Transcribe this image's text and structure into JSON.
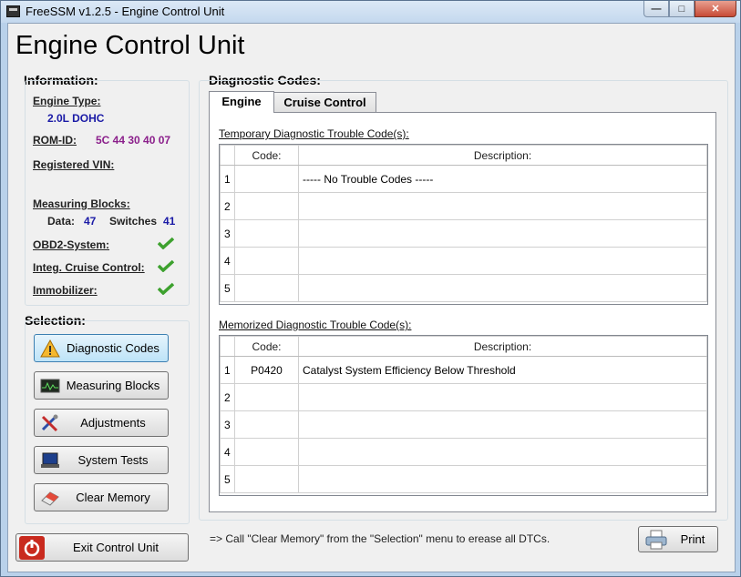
{
  "window": {
    "title": "FreeSSM v1.2.5 - Engine Control Unit",
    "minimize_glyph": "—",
    "maximize_glyph": "□",
    "close_glyph": "✕"
  },
  "app_title": "Engine Control Unit",
  "information": {
    "heading": "Information:",
    "engine_type_label": "Engine Type:",
    "engine_type_value": "2.0L DOHC",
    "rom_id_label": "ROM-ID:",
    "rom_id_value": "5C 44 30 40 07",
    "vin_label": "Registered VIN:",
    "measuring_blocks_label": "Measuring Blocks:",
    "data_label": "Data:",
    "data_value": "47",
    "switches_label": "Switches",
    "switches_value": "41",
    "obd2_label": "OBD2-System:",
    "cruise_label": "Integ. Cruise Control:",
    "immobilizer_label": "Immobilizer:",
    "check_color": "#3da12e"
  },
  "selection": {
    "heading": "Selection:",
    "buttons": [
      {
        "label": "Diagnostic Codes",
        "icon": "warning-icon"
      },
      {
        "label": "Measuring Blocks",
        "icon": "oscilloscope-icon"
      },
      {
        "label": "Adjustments",
        "icon": "tools-icon"
      },
      {
        "label": "System Tests",
        "icon": "laptop-icon"
      },
      {
        "label": "Clear Memory",
        "icon": "eraser-icon"
      }
    ]
  },
  "exit_button": {
    "label": "Exit Control Unit",
    "icon": "power-icon"
  },
  "diagnostic": {
    "heading": "Diagnostic Codes:",
    "tabs": [
      "Engine",
      "Cruise Control"
    ],
    "temporary": {
      "title": "Temporary Diagnostic Trouble Code(s):",
      "col_code": "Code:",
      "col_desc": "Description:",
      "rows": [
        {
          "num": "1",
          "code": "",
          "desc": "----- No Trouble Codes -----"
        },
        {
          "num": "2",
          "code": "",
          "desc": ""
        },
        {
          "num": "3",
          "code": "",
          "desc": ""
        },
        {
          "num": "4",
          "code": "",
          "desc": ""
        },
        {
          "num": "5",
          "code": "",
          "desc": ""
        }
      ]
    },
    "memorized": {
      "title": "Memorized Diagnostic Trouble Code(s):",
      "col_code": "Code:",
      "col_desc": "Description:",
      "rows": [
        {
          "num": "1",
          "code": "P0420",
          "desc": "Catalyst System Efficiency Below Threshold"
        },
        {
          "num": "2",
          "code": "",
          "desc": ""
        },
        {
          "num": "3",
          "code": "",
          "desc": ""
        },
        {
          "num": "4",
          "code": "",
          "desc": ""
        },
        {
          "num": "5",
          "code": "",
          "desc": ""
        }
      ]
    },
    "footer_text": "=> Call \"Clear Memory\" from the \"Selection\" menu to erease all DTCs.",
    "print_label": "Print"
  }
}
